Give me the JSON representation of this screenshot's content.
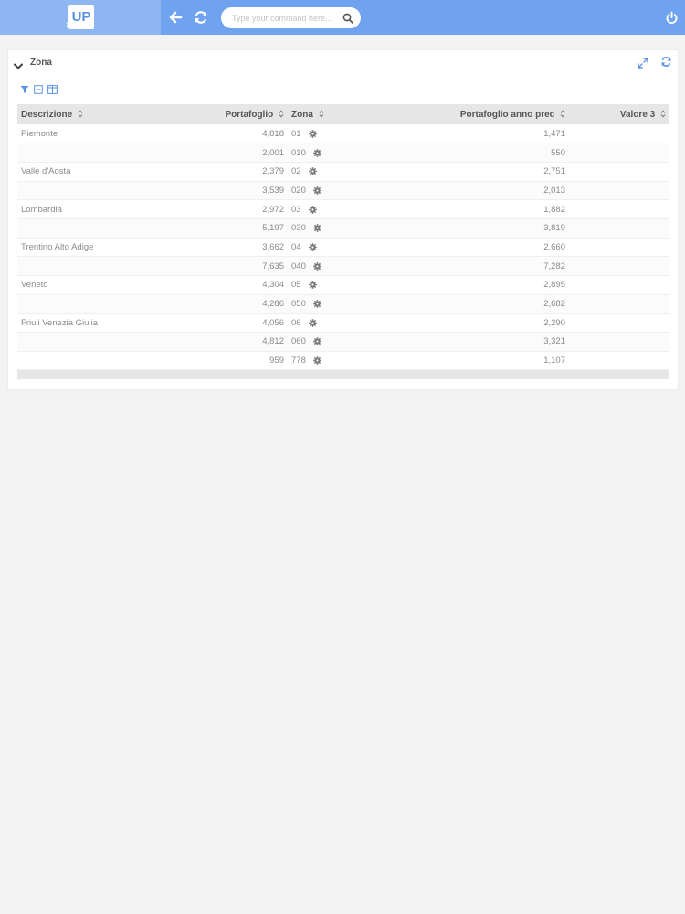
{
  "topbar": {
    "logo_text": "UP",
    "command_placeholder": "Type your command here..."
  },
  "panel": {
    "title": "Zona"
  },
  "table": {
    "columns": [
      "Descrizione",
      "Portafoglio",
      "Zona",
      "Portafoglio anno prec",
      "Valore 3"
    ],
    "rows": [
      {
        "descrizione": "Piemonte",
        "portafoglio": "4,818",
        "zona": "01",
        "anno_prec": "1,471",
        "valore3": ""
      },
      {
        "descrizione": "",
        "portafoglio": "2,001",
        "zona": "010",
        "anno_prec": "550",
        "valore3": ""
      },
      {
        "descrizione": "Valle d'Aosta",
        "portafoglio": "2,379",
        "zona": "02",
        "anno_prec": "2,751",
        "valore3": ""
      },
      {
        "descrizione": "",
        "portafoglio": "3,539",
        "zona": "020",
        "anno_prec": "2,013",
        "valore3": ""
      },
      {
        "descrizione": "Lombardia",
        "portafoglio": "2,972",
        "zona": "03",
        "anno_prec": "1,882",
        "valore3": ""
      },
      {
        "descrizione": "",
        "portafoglio": "5,197",
        "zona": "030",
        "anno_prec": "3,819",
        "valore3": ""
      },
      {
        "descrizione": "Trentino Alto Adige",
        "portafoglio": "3,662",
        "zona": "04",
        "anno_prec": "2,660",
        "valore3": ""
      },
      {
        "descrizione": "",
        "portafoglio": "7,635",
        "zona": "040",
        "anno_prec": "7,282",
        "valore3": ""
      },
      {
        "descrizione": "Veneto",
        "portafoglio": "4,304",
        "zona": "05",
        "anno_prec": "2,895",
        "valore3": ""
      },
      {
        "descrizione": "",
        "portafoglio": "4,286",
        "zona": "050",
        "anno_prec": "2,682",
        "valore3": ""
      },
      {
        "descrizione": "Friuli Venezia Giulia",
        "portafoglio": "4,056",
        "zona": "06",
        "anno_prec": "2,290",
        "valore3": ""
      },
      {
        "descrizione": "",
        "portafoglio": "4,812",
        "zona": "060",
        "anno_prec": "3,321",
        "valore3": ""
      },
      {
        "descrizione": "",
        "portafoglio": "959",
        "zona": "778",
        "anno_prec": "1,107",
        "valore3": ""
      }
    ]
  },
  "icons": {
    "back": "arrow-left-icon",
    "refresh": "refresh-icon",
    "search": "search-icon",
    "power": "power-icon",
    "collapse": "chevron-down-icon",
    "expand": "expand-icon",
    "filter": "filter-icon",
    "collapse_all": "collapse-all-icon",
    "columns": "columns-icon",
    "sort": "sort-icon",
    "gear": "gear-icon"
  },
  "colors": {
    "topbar": "#6fa3f0",
    "logo_zone": "#8db6f3",
    "accent": "#5b92e6",
    "header_row": "#e6e6e6"
  }
}
